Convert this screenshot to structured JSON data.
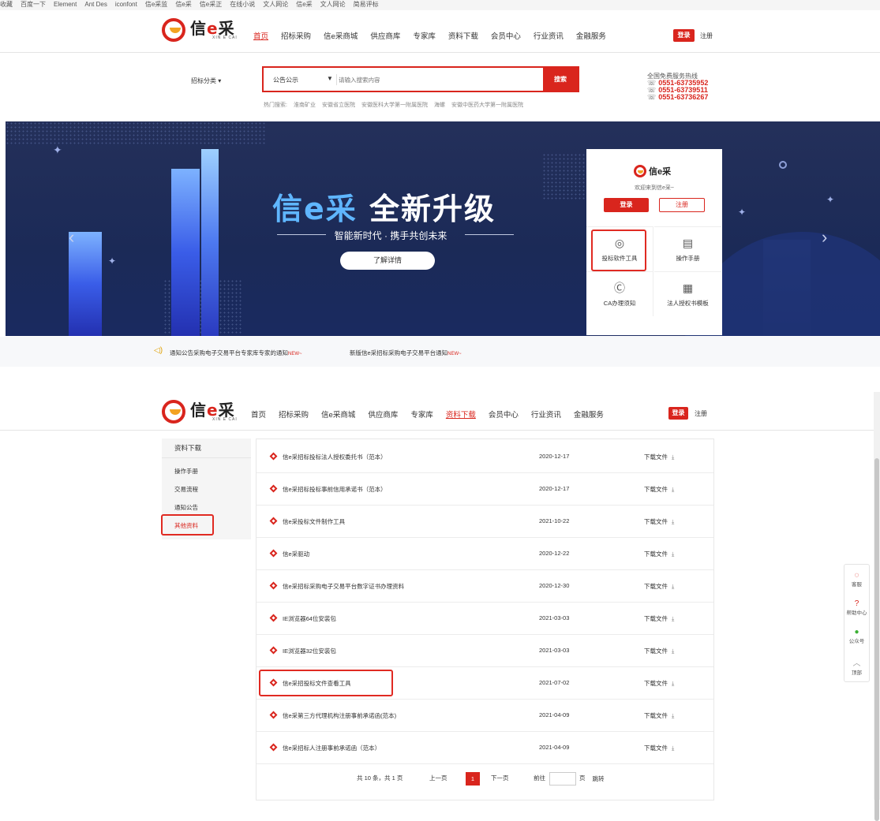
{
  "bookmarks": [
    "收藏",
    "百度一下",
    "Element",
    "Ant Des",
    "iconfont",
    "信e采监",
    "信e采",
    "信e采正",
    "在线小说",
    "文人网论",
    "信e采",
    "文人网论",
    "简易评标"
  ],
  "header": {
    "logo_cn": "信e采",
    "logo_en": "XIN E CAI",
    "nav": [
      "首页",
      "招标采购",
      "信e采商城",
      "供应商库",
      "专家库",
      "资料下载",
      "会员中心",
      "行业资讯",
      "金融服务"
    ],
    "nav_active": 0,
    "login": "登录",
    "register": "注册"
  },
  "search": {
    "category_label": "招标分类",
    "category_arrow": "▾",
    "type": "公告公示",
    "type_arrow": "▼",
    "placeholder": "请输入搜索内容",
    "button": "搜索",
    "hot_label": "热门搜索:",
    "hot": [
      "淮南矿业",
      "安徽省立医院",
      "安徽医科大学第一附属医院",
      "海螺",
      "安徽中医药大学第一附属医院"
    ]
  },
  "hotline": {
    "title": "全国免费服务热线",
    "phones": [
      "0551-63735952",
      "0551-63739511",
      "0551-63736267"
    ]
  },
  "banner": {
    "title_a": "信e采",
    "title_b": "全新升级",
    "subtitle": "智能新时代 · 携手共创未来",
    "button": "了解详情",
    "prev": "‹",
    "next": "›"
  },
  "login_card": {
    "logo": "信e采",
    "welcome": "欢迎来到信e采~",
    "login": "登录",
    "register": "注册",
    "tools": [
      {
        "label": "投标软件工具",
        "icon": "target-icon"
      },
      {
        "label": "操作手册",
        "icon": "manual-icon"
      },
      {
        "label": "CA办理须知",
        "icon": "ca-icon"
      },
      {
        "label": "法人授权书模板",
        "icon": "document-icon"
      }
    ]
  },
  "notices": [
    {
      "text": "通知公告采购电子交易平台专家库专家的通知",
      "tag": "NEW~"
    },
    {
      "text": "新版信e采招标采购电子交易平台通知",
      "tag": "NEW~"
    }
  ],
  "header2": {
    "nav": [
      "首页",
      "招标采购",
      "信e采商城",
      "供应商库",
      "专家库",
      "资料下载",
      "会员中心",
      "行业资讯",
      "金融服务"
    ],
    "nav_active": 5,
    "login": "登录",
    "register": "注册"
  },
  "sidebar": {
    "title": "资料下载",
    "items": [
      "操作手册",
      "交易流程",
      "通知公告",
      "其他资料"
    ],
    "active": 3
  },
  "files": [
    {
      "name": "信e采招标投标法人授权委托书（范本）",
      "date": "2020-12-17"
    },
    {
      "name": "信e采招标投标事前信用承诺书（范本）",
      "date": "2020-12-17"
    },
    {
      "name": "信e采投标文件制作工具",
      "date": "2021-10-22"
    },
    {
      "name": "信e采驱动",
      "date": "2020-12-22"
    },
    {
      "name": "信e采招标采购电子交易平台数字证书办理资料",
      "date": "2020-12-30"
    },
    {
      "name": "IE浏览器64位安装包",
      "date": "2021-03-03"
    },
    {
      "name": "IE浏览器32位安装包",
      "date": "2021-03-03"
    },
    {
      "name": "信e采招投标文件查看工具",
      "date": "2021-07-02"
    },
    {
      "name": "信e采第三方代理机构注册事前承诺函(范本)",
      "date": "2021-04-09"
    },
    {
      "name": "信e采招标人注册事前承诺函（范本）",
      "date": "2021-04-09"
    }
  ],
  "download_label": "下载文件",
  "pager": {
    "summary": "共 10 条，共 1 页",
    "prev": "上一页",
    "current": "1",
    "next": "下一页",
    "goto": "前往",
    "page_unit": "页",
    "jump": "跳转"
  },
  "float": [
    {
      "icon": "customer-service-icon",
      "label": "客服",
      "glyph": "◌"
    },
    {
      "icon": "help-icon",
      "label": "帮助中心",
      "glyph": "?"
    },
    {
      "icon": "wechat-icon",
      "label": "公众号",
      "glyph": "●"
    },
    {
      "icon": "top-icon",
      "label": "顶部",
      "glyph": "︿"
    }
  ],
  "colors": {
    "brand_red": "#d9251d",
    "banner_bg": "#1b2a57"
  }
}
